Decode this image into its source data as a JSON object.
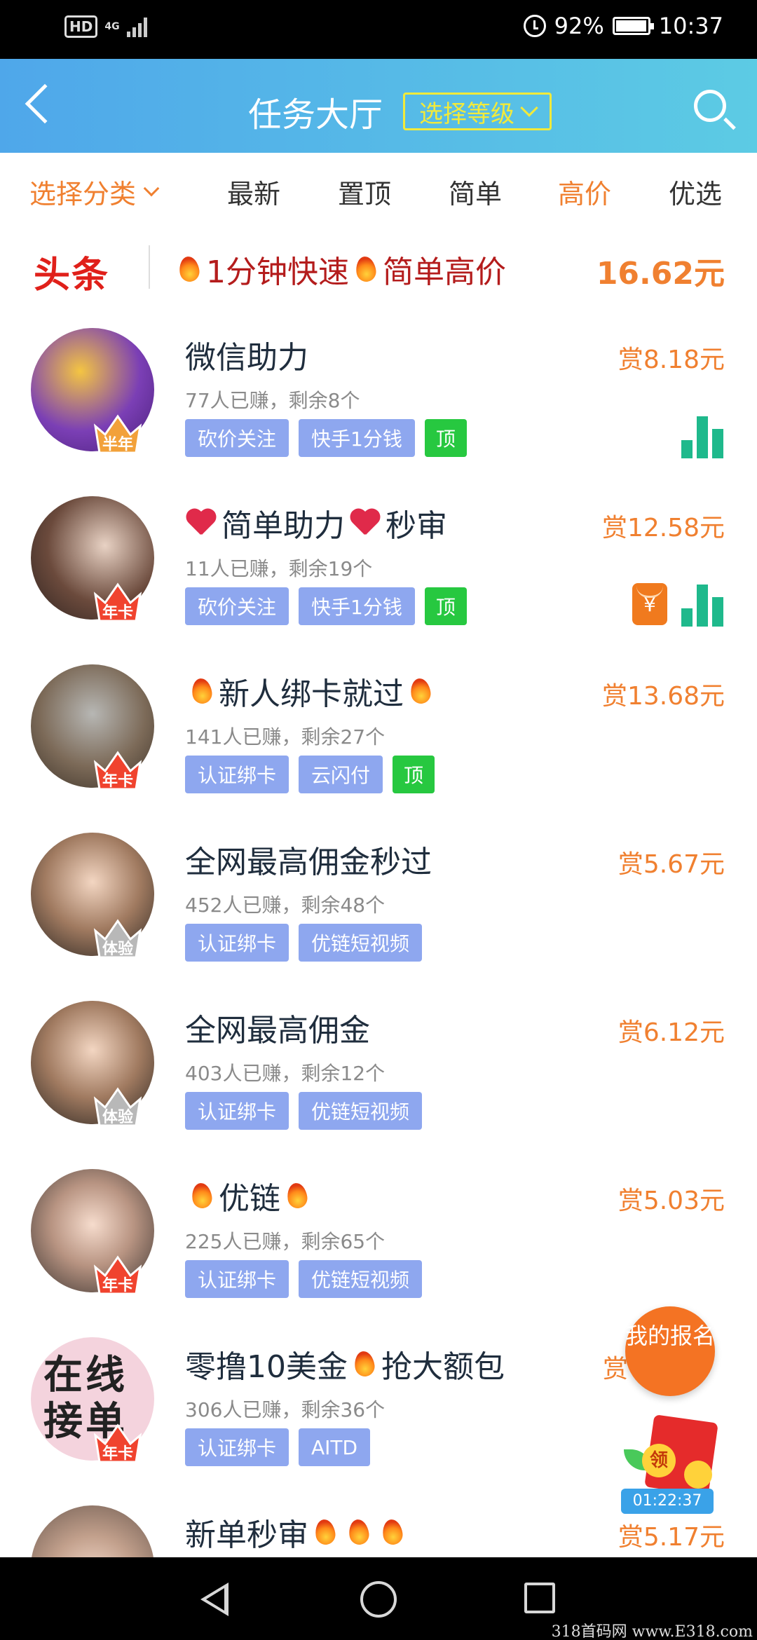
{
  "status_bar": {
    "hd": "HD",
    "network": "4G",
    "battery": "92%",
    "time": "10:37"
  },
  "header": {
    "title": "任务大厅",
    "level_select": "选择等级"
  },
  "filters": {
    "category": "选择分类",
    "tabs": [
      "最新",
      "置顶",
      "简单",
      "高价",
      "优选"
    ],
    "active_tab": "高价"
  },
  "banner": {
    "logo": "头条",
    "text_part1": "1分钟快速",
    "text_part2": "简单高价",
    "price": "16.62元"
  },
  "tasks": [
    {
      "title": "微信助力",
      "meta": "77人已赚，剩余8个",
      "reward": "赏8.18元",
      "badge": "半年",
      "tags": [
        "砍价关注",
        "快手1分钱"
      ],
      "top": "顶"
    },
    {
      "title_a": "简单助力",
      "title_b": "秒审",
      "meta": "11人已赚，剩余19个",
      "reward": "赏12.58元",
      "badge": "年卡",
      "tags": [
        "砍价关注",
        "快手1分钱"
      ],
      "top": "顶",
      "hongbao": "¥"
    },
    {
      "title": "新人绑卡就过",
      "meta": "141人已赚，剩余27个",
      "reward": "赏13.68元",
      "badge": "年卡",
      "tags": [
        "认证绑卡",
        "云闪付"
      ],
      "top": "顶"
    },
    {
      "title": "全网最高佣金秒过",
      "meta": "452人已赚，剩余48个",
      "reward": "赏5.67元",
      "badge": "体验",
      "tags": [
        "认证绑卡",
        "优链短视频"
      ]
    },
    {
      "title": "全网最高佣金",
      "meta": "403人已赚，剩余12个",
      "reward": "赏6.12元",
      "badge": "体验",
      "tags": [
        "认证绑卡",
        "优链短视频"
      ]
    },
    {
      "title": "优链",
      "meta": "225人已赚，剩余65个",
      "reward": "赏5.03元",
      "badge": "年卡",
      "tags": [
        "认证绑卡",
        "优链短视频"
      ]
    },
    {
      "title_a": "零撸10美金",
      "title_b": "抢大额包",
      "meta": "306人已赚，剩余36个",
      "reward": "赏",
      "badge": "年卡",
      "avatar_text": "在线接单",
      "tags": [
        "认证绑卡",
        "AITD"
      ]
    },
    {
      "title": "新单秒审",
      "reward": "赏5.17元"
    }
  ],
  "floating": {
    "signup": "我的报名",
    "redpacket": "领",
    "timer": "01:22:37"
  },
  "watermark": "318首码网 www.E318.com",
  "colors": {
    "accent_orange": "#f08030",
    "header_gradient_start": "#4fa7ea",
    "header_gradient_end": "#5ccbe4",
    "tag_blue": "#8ea7ef",
    "tag_green": "#27c840",
    "banner_red": "#b41c1c"
  }
}
